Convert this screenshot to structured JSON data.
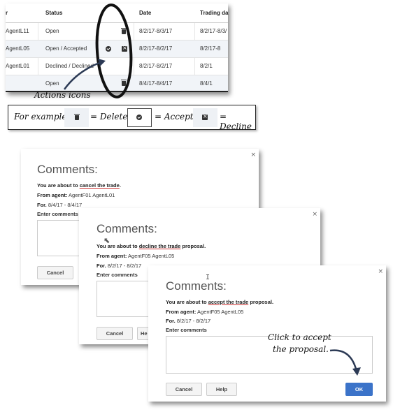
{
  "table": {
    "headers": {
      "agent": "r",
      "status": "Status",
      "date": "Date",
      "trading": "Trading da"
    },
    "rows": [
      {
        "agent": "AgentL11",
        "status": "Open",
        "date": "8/2/17-8/3/17",
        "trading": "8/2/17-8/3/"
      },
      {
        "agent": "AgentL05",
        "status": "Open / Accepted",
        "date": "8/2/17-8/2/17",
        "trading": "8/2/17-8"
      },
      {
        "agent": "AgentL01",
        "status": "Declined / Declined",
        "date": "8/2/17-8/2/17",
        "trading": "8/2/1"
      },
      {
        "agent": "",
        "status": "Open",
        "date": "8/4/17-8/4/17",
        "trading": "8/4/1"
      }
    ]
  },
  "annotation": {
    "actions_icons": "Actions icons"
  },
  "example": {
    "prefix": "For example:",
    "delete": "= Delete,",
    "accept": "= Accept,",
    "decline": "= Decline"
  },
  "dialogs": {
    "cancel_dialog": {
      "title": "Comments:",
      "about_prefix": "You are about to ",
      "about_action": "cancel the trade",
      "about_suffix": ".",
      "from_label": "From agent:",
      "from_value": "AgentF01 AgentL01",
      "for_label": "For.",
      "for_value": "8/4/17 - 8/4/17",
      "enter_comments": "Enter comments",
      "cancel_button": "Cancel"
    },
    "decline_dialog": {
      "title": "Comments:",
      "about_prefix": "You are about to ",
      "about_action": "decline the trade",
      "about_suffix": " proposal.",
      "from_label": "From agent:",
      "from_value": "AgentF05 AgentL05",
      "for_label": "For.",
      "for_value": "8/2/17 - 8/2/17",
      "enter_comments": "Enter comments",
      "cancel_button": "Cancel",
      "help_button_partial": "He"
    },
    "accept_dialog": {
      "title": "Comments:",
      "about_prefix": "You are about to ",
      "about_action": "accept the trade",
      "about_suffix": " proposal.",
      "from_label": "From agent:",
      "from_value": "AgentF05 AgentL05",
      "for_label": "For.",
      "for_value": "8/2/17 - 8/2/17",
      "enter_comments": "Enter comments",
      "cancel_button": "Cancel",
      "help_button": "Help",
      "ok_button": "OK",
      "callout_line1": "Click to accept",
      "callout_line2": "the proposal."
    }
  },
  "close_symbol": "×",
  "colors": {
    "ok_button": "#3b73c9",
    "underline": "#cc3333",
    "row_alt": "#f1f4f8"
  }
}
